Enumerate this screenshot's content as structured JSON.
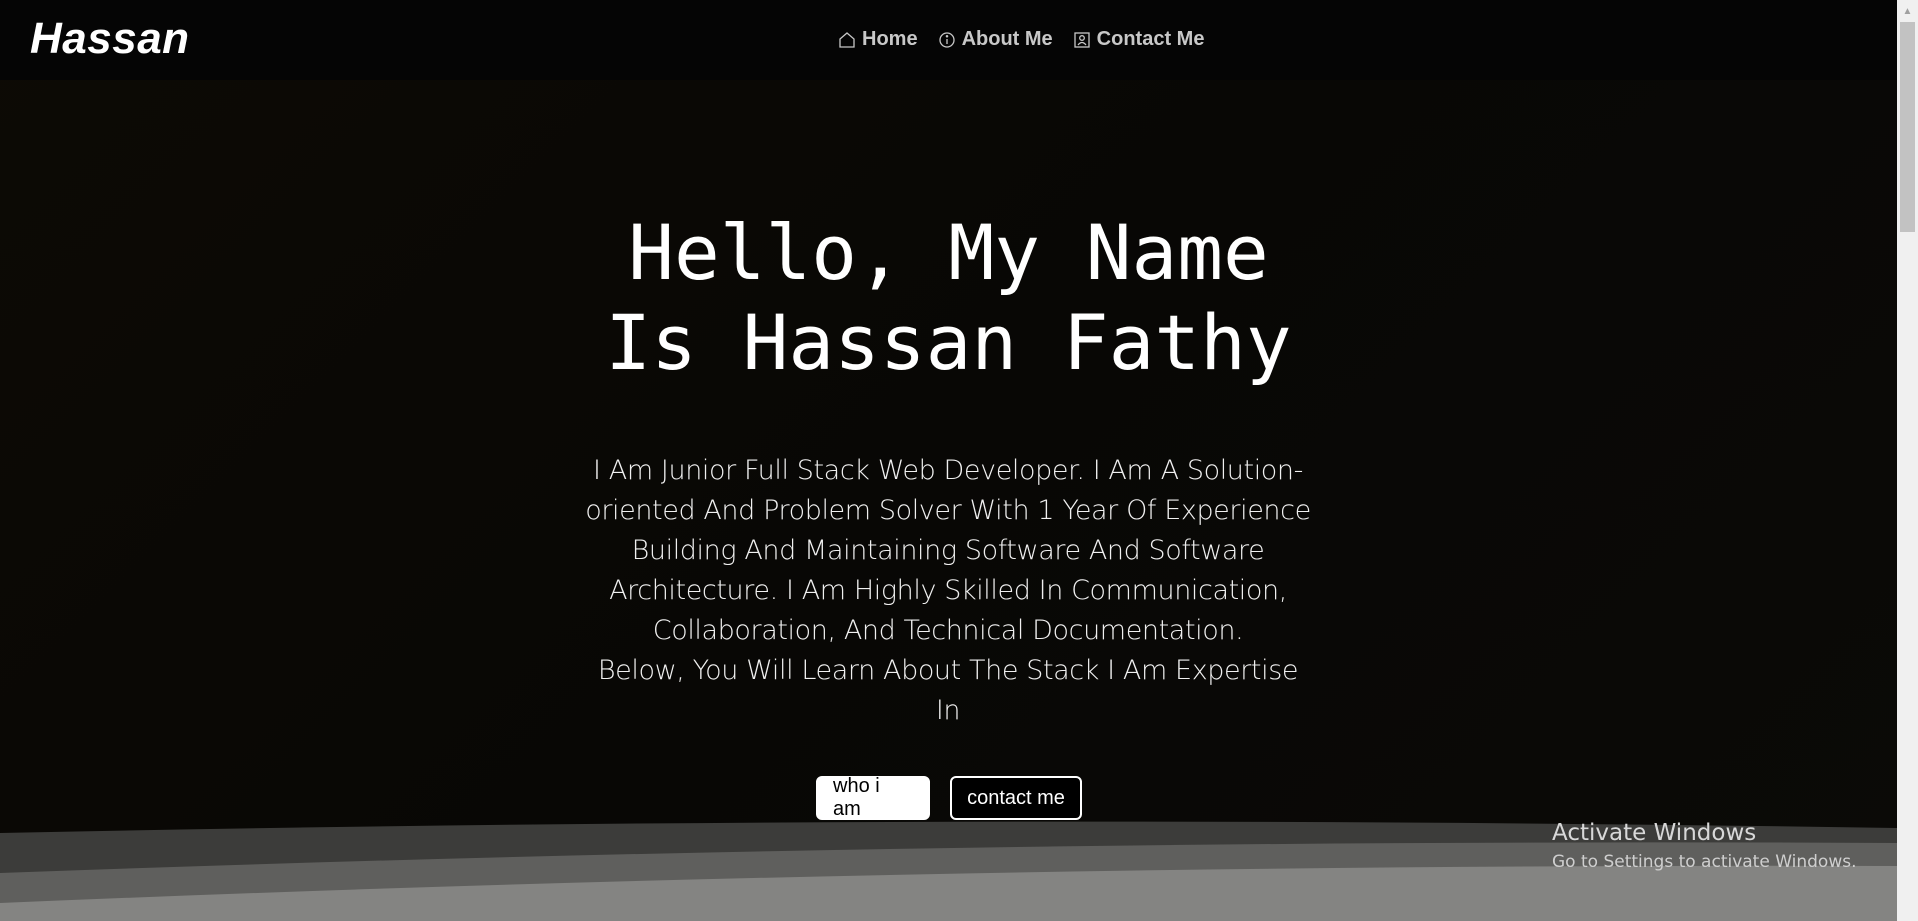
{
  "navbar": {
    "brand": "Hassan",
    "links": [
      {
        "label": "Home",
        "icon": "home-icon"
      },
      {
        "label": "About Me",
        "icon": "info-icon"
      },
      {
        "label": "Contact Me",
        "icon": "contact-icon"
      }
    ]
  },
  "hero": {
    "title_lines": [
      "Hello, My Name",
      "Is Hassan Fathy"
    ],
    "description_lines": [
      "I Am Junior Full Stack Web Developer. I Am A Solution-",
      "oriented And Problem Solver With 1 Year Of Experience",
      "Building And Maintaining Software And Software",
      "Architecture. I Am Highly Skilled In Communication,",
      "Collaboration, And Technical Documentation.",
      "Below, You Will Learn About The Stack I Am Expertise",
      "In"
    ],
    "primary_button": "who i am",
    "secondary_button": "contact me"
  },
  "watermark": {
    "title": "Activate Windows",
    "subtitle": "Go to Settings to activate Windows."
  },
  "colors": {
    "background": "#0a0805",
    "navbar": "#050505",
    "text": "#ffffff",
    "nav_link": "#c8c8c8"
  }
}
